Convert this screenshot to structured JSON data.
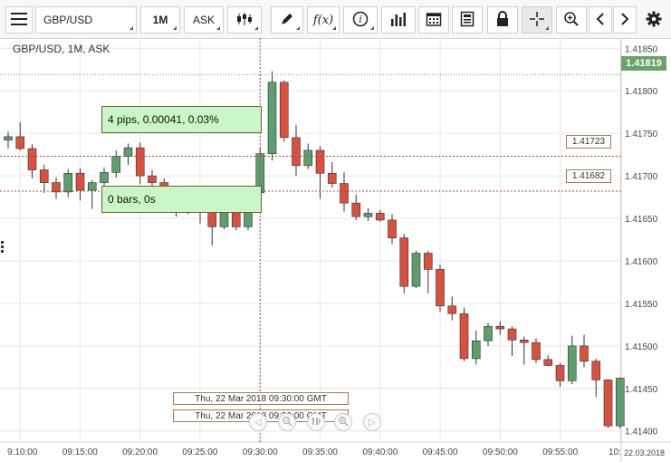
{
  "toolbar": {
    "menu_icon": "hamburger-icon",
    "symbol": "GBP/USD",
    "timeframe": "1M",
    "price_type": "ASK",
    "chart_type_icon": "candlestick-icon",
    "draw_icon": "pencil-icon",
    "indicators_label": "f(x)",
    "info_icon": "info-icon",
    "volume_icon": "bar-chart-icon",
    "calendar_icon": "calendar-icon",
    "template_icon": "document-icon",
    "lock_icon": "lock-icon",
    "crosshair_icon": "crosshair-icon",
    "zoom_icon": "zoom-in-icon",
    "prev_icon": "chevron-left-icon",
    "next_icon": "chevron-right-icon",
    "settings_icon": "gear-icon"
  },
  "chart": {
    "legend": "GBP/USD, 1M, ASK",
    "current_price": "1.41819",
    "measure_top": "4 pips, 0.00041, 0.03%",
    "measure_bottom": "0 bars, 0s",
    "level_high": "1.41723",
    "level_low": "1.41682",
    "crosshair_time_1": "Thu, 22 Mar 2018 09:30:00 GMT",
    "crosshair_time_2": "Thu, 22 Mar 2018 09:30:00 GMT",
    "date_label": "22.03.2018",
    "colors": {
      "up": "#5e9e6e",
      "down": "#d9503f",
      "grid": "#e6e6e6",
      "crosshair": "#a0522d"
    }
  },
  "chart_data": {
    "type": "candlestick",
    "x_ticks": [
      "9:10:00",
      "09:15:00",
      "09:20:00",
      "09:25:00",
      "09:30:00",
      "09:35:00",
      "09:40:00",
      "09:45:00",
      "09:50:00",
      "09:55:00",
      "10:"
    ],
    "y_ticks": [
      "1.41850",
      "1.41800",
      "1.41750",
      "1.41700",
      "1.41650",
      "1.41600",
      "1.41550",
      "1.41500",
      "1.41450",
      "1.41400"
    ],
    "ylim": [
      1.41388,
      1.41862
    ],
    "candles": [
      {
        "o": 1.41742,
        "h": 1.41752,
        "l": 1.41732,
        "c": 1.41746
      },
      {
        "o": 1.41746,
        "h": 1.41763,
        "l": 1.4173,
        "c": 1.41732
      },
      {
        "o": 1.41732,
        "h": 1.41737,
        "l": 1.41697,
        "c": 1.41707
      },
      {
        "o": 1.41707,
        "h": 1.41713,
        "l": 1.4168,
        "c": 1.41692
      },
      {
        "o": 1.41692,
        "h": 1.41698,
        "l": 1.41673,
        "c": 1.41681
      },
      {
        "o": 1.41681,
        "h": 1.41708,
        "l": 1.41675,
        "c": 1.41703
      },
      {
        "o": 1.41703,
        "h": 1.41709,
        "l": 1.41671,
        "c": 1.41683
      },
      {
        "o": 1.41683,
        "h": 1.41695,
        "l": 1.41661,
        "c": 1.41692
      },
      {
        "o": 1.41692,
        "h": 1.4171,
        "l": 1.41681,
        "c": 1.41704
      },
      {
        "o": 1.41704,
        "h": 1.4173,
        "l": 1.41698,
        "c": 1.41723
      },
      {
        "o": 1.41723,
        "h": 1.41738,
        "l": 1.41713,
        "c": 1.41733
      },
      {
        "o": 1.41733,
        "h": 1.41739,
        "l": 1.4169,
        "c": 1.417
      },
      {
        "o": 1.417,
        "h": 1.41707,
        "l": 1.41685,
        "c": 1.41692
      },
      {
        "o": 1.41692,
        "h": 1.41697,
        "l": 1.41663,
        "c": 1.41673
      },
      {
        "o": 1.41673,
        "h": 1.41681,
        "l": 1.41652,
        "c": 1.41668
      },
      {
        "o": 1.41668,
        "h": 1.41678,
        "l": 1.41655,
        "c": 1.41661
      },
      {
        "o": 1.41661,
        "h": 1.41674,
        "l": 1.41644,
        "c": 1.41658
      },
      {
        "o": 1.41658,
        "h": 1.41667,
        "l": 1.41618,
        "c": 1.4164
      },
      {
        "o": 1.4164,
        "h": 1.4167,
        "l": 1.41637,
        "c": 1.4166
      },
      {
        "o": 1.4166,
        "h": 1.41668,
        "l": 1.41636,
        "c": 1.4164
      },
      {
        "o": 1.4164,
        "h": 1.41685,
        "l": 1.41636,
        "c": 1.4168
      },
      {
        "o": 1.4168,
        "h": 1.41733,
        "l": 1.41676,
        "c": 1.41726
      },
      {
        "o": 1.41726,
        "h": 1.41823,
        "l": 1.41718,
        "c": 1.4181
      },
      {
        "o": 1.4181,
        "h": 1.41812,
        "l": 1.4174,
        "c": 1.41745
      },
      {
        "o": 1.41745,
        "h": 1.4176,
        "l": 1.417,
        "c": 1.41712
      },
      {
        "o": 1.41712,
        "h": 1.41738,
        "l": 1.41708,
        "c": 1.4173
      },
      {
        "o": 1.4173,
        "h": 1.41735,
        "l": 1.41673,
        "c": 1.41703
      },
      {
        "o": 1.41703,
        "h": 1.41716,
        "l": 1.41686,
        "c": 1.41691
      },
      {
        "o": 1.41691,
        "h": 1.41704,
        "l": 1.41658,
        "c": 1.41668
      },
      {
        "o": 1.41668,
        "h": 1.41678,
        "l": 1.41648,
        "c": 1.41652
      },
      {
        "o": 1.41652,
        "h": 1.41662,
        "l": 1.41647,
        "c": 1.41656
      },
      {
        "o": 1.41656,
        "h": 1.4166,
        "l": 1.41646,
        "c": 1.41648
      },
      {
        "o": 1.41648,
        "h": 1.41655,
        "l": 1.4162,
        "c": 1.41627
      },
      {
        "o": 1.41627,
        "h": 1.41632,
        "l": 1.41562,
        "c": 1.4157
      },
      {
        "o": 1.4157,
        "h": 1.41612,
        "l": 1.41568,
        "c": 1.41609
      },
      {
        "o": 1.41609,
        "h": 1.41612,
        "l": 1.41562,
        "c": 1.4159
      },
      {
        "o": 1.4159,
        "h": 1.41595,
        "l": 1.4154,
        "c": 1.41547
      },
      {
        "o": 1.41547,
        "h": 1.41558,
        "l": 1.4153,
        "c": 1.41538
      },
      {
        "o": 1.41538,
        "h": 1.41545,
        "l": 1.41482,
        "c": 1.41485
      },
      {
        "o": 1.41485,
        "h": 1.41518,
        "l": 1.41478,
        "c": 1.41506
      },
      {
        "o": 1.41506,
        "h": 1.41527,
        "l": 1.415,
        "c": 1.41523
      },
      {
        "o": 1.41523,
        "h": 1.41529,
        "l": 1.41513,
        "c": 1.4152
      },
      {
        "o": 1.4152,
        "h": 1.41523,
        "l": 1.41488,
        "c": 1.41507
      },
      {
        "o": 1.41507,
        "h": 1.41511,
        "l": 1.41478,
        "c": 1.41504
      },
      {
        "o": 1.41504,
        "h": 1.41509,
        "l": 1.4148,
        "c": 1.41484
      },
      {
        "o": 1.41484,
        "h": 1.41489,
        "l": 1.41476,
        "c": 1.41477
      },
      {
        "o": 1.41477,
        "h": 1.4148,
        "l": 1.41452,
        "c": 1.41459
      },
      {
        "o": 1.41459,
        "h": 1.41512,
        "l": 1.41455,
        "c": 1.415
      },
      {
        "o": 1.415,
        "h": 1.41513,
        "l": 1.41475,
        "c": 1.41482
      },
      {
        "o": 1.41482,
        "h": 1.41485,
        "l": 1.4144,
        "c": 1.4146
      },
      {
        "o": 1.4146,
        "h": 1.41461,
        "l": 1.41404,
        "c": 1.41406
      },
      {
        "o": 1.41406,
        "h": 1.41463,
        "l": 1.41403,
        "c": 1.41462
      }
    ]
  }
}
